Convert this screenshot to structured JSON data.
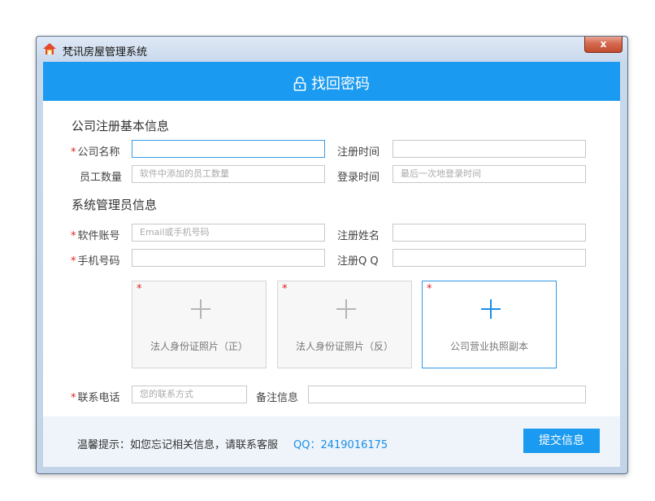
{
  "window": {
    "title": "梵讯房屋管理系统",
    "close_label": "x"
  },
  "header": {
    "title": "找回密码",
    "icon": "lock-icon"
  },
  "company_section": {
    "title": "公司注册基本信息",
    "company_name": {
      "label": "公司名称",
      "required": true,
      "value": "",
      "placeholder": ""
    },
    "register_time": {
      "label": "注册时间",
      "value": "",
      "placeholder": ""
    },
    "employee_count": {
      "label": "员工数量",
      "placeholder": "软件中添加的员工数量"
    },
    "login_time": {
      "label": "登录时间",
      "placeholder": "最后一次地登录时间"
    }
  },
  "admin_section": {
    "title": "系统管理员信息",
    "account": {
      "label": "软件账号",
      "required": true,
      "placeholder": "Email或手机号码"
    },
    "register_name": {
      "label": "注册姓名",
      "placeholder": ""
    },
    "phone": {
      "label": "手机号码",
      "required": true,
      "placeholder": ""
    },
    "register_qq": {
      "label": "注册Q Q",
      "placeholder": ""
    }
  },
  "uploads": [
    {
      "caption": "法人身份证照片（正）",
      "required": true,
      "active": false
    },
    {
      "caption": "法人身份证照片（反）",
      "required": true,
      "active": false
    },
    {
      "caption": "公司营业执照副本",
      "required": true,
      "active": true
    }
  ],
  "contact": {
    "phone_label": "联系电话",
    "phone_placeholder": "您的联系方式",
    "remark_label": "备注信息",
    "remark_placeholder": ""
  },
  "footer": {
    "tip": "温馨提示：如您忘记相关信息，请联系客服",
    "qq": "QQ：2419016175",
    "submit_label": "提交信息"
  },
  "colors": {
    "accent": "#1a9af0",
    "required": "#e02020",
    "footer_bg": "#eef4fa"
  }
}
